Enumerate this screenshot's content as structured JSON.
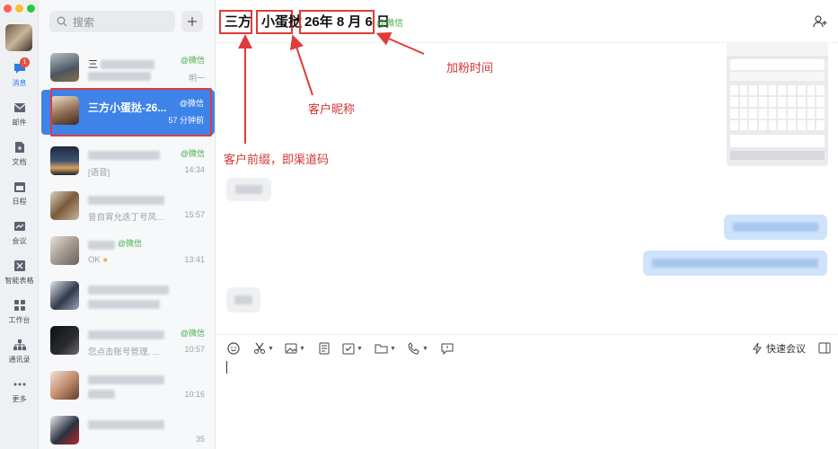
{
  "nav": {
    "items": [
      {
        "label": "消息",
        "badge": "1"
      },
      {
        "label": "邮件"
      },
      {
        "label": "文档"
      },
      {
        "label": "日程"
      },
      {
        "label": "会议"
      },
      {
        "label": "智能表格"
      },
      {
        "label": "工作台"
      },
      {
        "label": "通讯录"
      },
      {
        "label": "更多"
      }
    ]
  },
  "search": {
    "placeholder": "搜索"
  },
  "conversations": [
    {
      "name": "三",
      "source": "@微信",
      "preview": "明一",
      "time": ""
    },
    {
      "name": "三方小蛋挞-26...",
      "source": "@微信",
      "preview": "",
      "time": "57 分钟前",
      "selected": true
    },
    {
      "name": "",
      "source": "@微信",
      "preview": "[语音]",
      "time": "14:34"
    },
    {
      "name": "",
      "source": "",
      "preview": "昔自宵允迭丁号风...",
      "time": "15:57"
    },
    {
      "name": "",
      "source": "@微信",
      "preview": "OK",
      "time": "13:41"
    },
    {
      "name": "",
      "source": "",
      "preview": "",
      "time": ""
    },
    {
      "name": "",
      "source": "@微信",
      "preview": "您点击账号管理, ...",
      "time": "10:57"
    },
    {
      "name": "",
      "source": "",
      "preview": "",
      "time": "10:16"
    },
    {
      "name": "",
      "source": "",
      "preview": "",
      "time": "35"
    }
  ],
  "chat": {
    "title_prefix": "三方",
    "title_nickname": "小蛋挞",
    "title_date": "26年 8 月 6 日",
    "title_sep": "-",
    "source": "@微信",
    "quick_meeting": "快速会议"
  },
  "annotations": {
    "prefix": "客户前缀，即渠道码",
    "nickname": "客户昵称",
    "date": "加粉时间"
  },
  "colors": {
    "accent": "#3d83e8",
    "annotation": "#e03b3b",
    "wechat_green": "#46b14e"
  }
}
